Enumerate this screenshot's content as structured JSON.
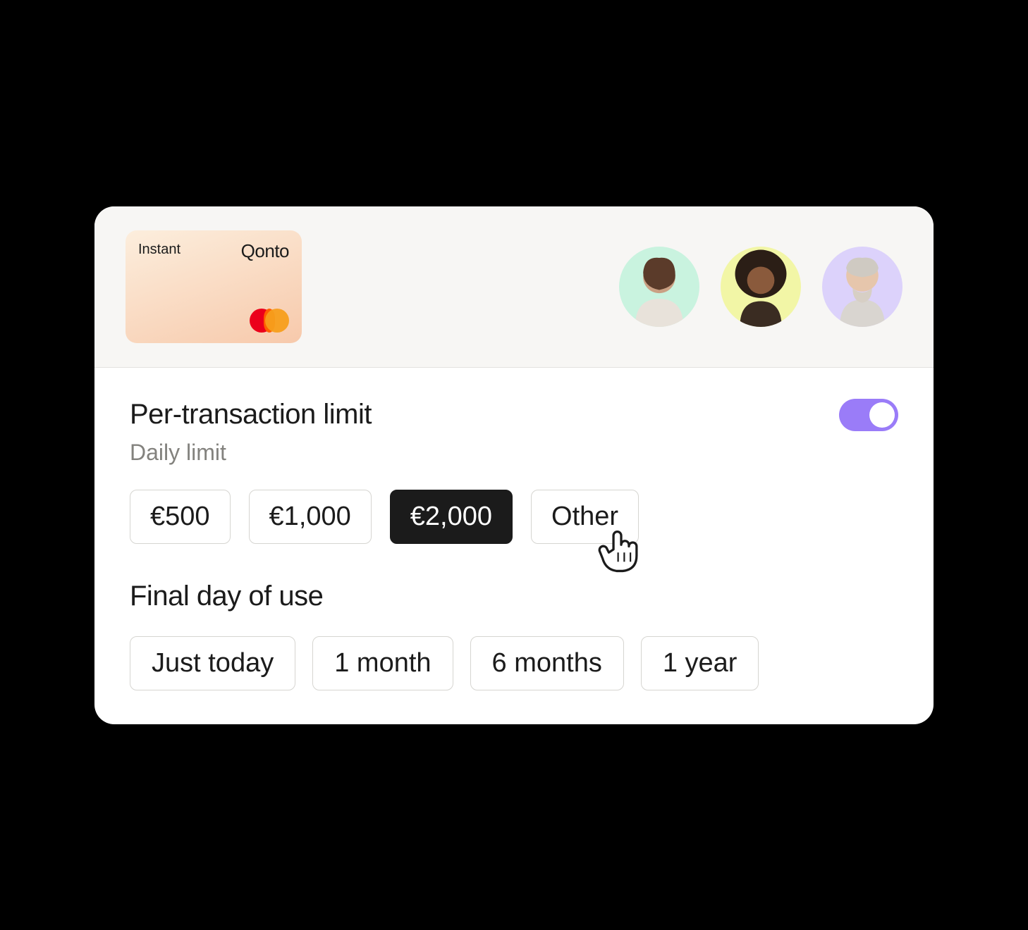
{
  "header": {
    "card": {
      "tag": "Instant",
      "brand": "Qonto"
    },
    "avatars": [
      {
        "bg": "#c9f3df",
        "name": "avatar-1"
      },
      {
        "bg": "#f2f6a6",
        "name": "avatar-2"
      },
      {
        "bg": "#dcd2fb",
        "name": "avatar-3"
      }
    ]
  },
  "limits": {
    "title": "Per-transaction limit",
    "toggle_on": true,
    "subtitle": "Daily limit",
    "options": [
      {
        "label": "€500",
        "selected": false
      },
      {
        "label": "€1,000",
        "selected": false
      },
      {
        "label": "€2,000",
        "selected": true
      },
      {
        "label": "Other",
        "selected": false
      }
    ]
  },
  "duration": {
    "title": "Final day of use",
    "options": [
      {
        "label": "Just today"
      },
      {
        "label": "1 month"
      },
      {
        "label": "6 months"
      },
      {
        "label": "1 year"
      }
    ]
  },
  "colors": {
    "accent": "#9a7cf8",
    "text": "#1b1b1b",
    "muted": "#83827e",
    "border": "#d6d5d1",
    "header_bg": "#f7f6f4"
  }
}
